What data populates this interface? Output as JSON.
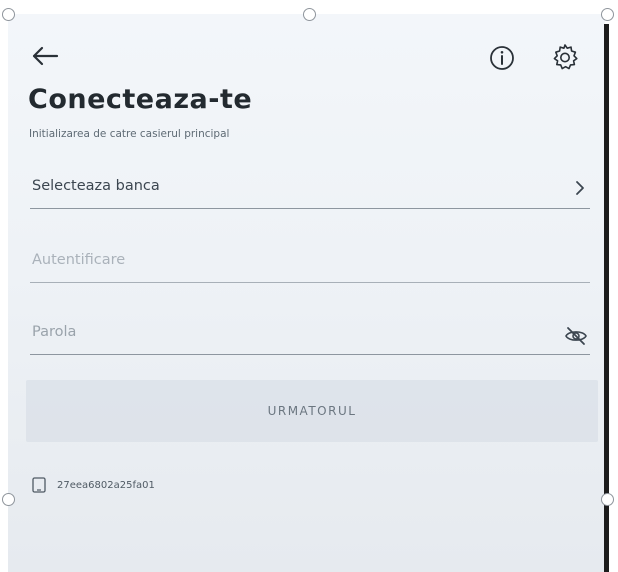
{
  "toolbar": {
    "back_icon": "arrow-left-icon",
    "info_icon": "info-icon",
    "settings_icon": "gear-icon"
  },
  "header": {
    "title": "Conecteaza-te",
    "subtitle": "Initializarea de catre casierul principal"
  },
  "form": {
    "bank_label": "Selecteaza banca",
    "auth_placeholder": "Autentificare",
    "password_placeholder": "Parola",
    "password_toggle_icon": "eye-off-icon",
    "next_label": "URMATORUL"
  },
  "device": {
    "icon": "tablet-icon",
    "id": "27eea6802a25fa01"
  },
  "colors": {
    "title": "#232a30",
    "background": "#eef2f6",
    "button": "#d3dbe3"
  }
}
